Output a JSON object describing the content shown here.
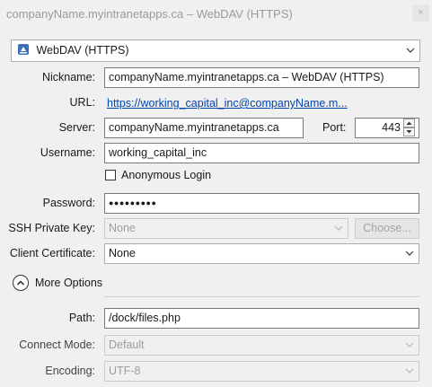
{
  "window": {
    "title": "companyName.myintranetapps.ca – WebDAV (HTTPS)",
    "close_glyph": "×"
  },
  "protocol": {
    "value": "WebDAV (HTTPS)",
    "icon": "drive-icon"
  },
  "form": {
    "nickname": {
      "label": "Nickname:",
      "value": "companyName.myintranetapps.ca – WebDAV (HTTPS)"
    },
    "url": {
      "label": "URL:",
      "value": "https://working_capital_inc@companyName.m..."
    },
    "server": {
      "label": "Server:",
      "value": "companyName.myintranetapps.ca"
    },
    "port": {
      "label": "Port:",
      "value": "443"
    },
    "username": {
      "label": "Username:",
      "value": "working_capital_inc"
    },
    "anonymous": {
      "label": "Anonymous Login",
      "checked": false
    },
    "password": {
      "label": "Password:",
      "value": "●●●●●●●●●"
    },
    "ssh_key": {
      "label": "SSH Private Key:",
      "value": "None",
      "choose_label": "Choose..."
    },
    "client_cert": {
      "label": "Client Certificate:",
      "value": "None"
    }
  },
  "more_options": {
    "label": "More Options",
    "expanded": true
  },
  "advanced": {
    "path": {
      "label": "Path:",
      "value": "/dock/files.php"
    },
    "connect_mode": {
      "label": "Connect Mode:",
      "value": "Default"
    },
    "encoding": {
      "label": "Encoding:",
      "value": "UTF-8"
    }
  }
}
